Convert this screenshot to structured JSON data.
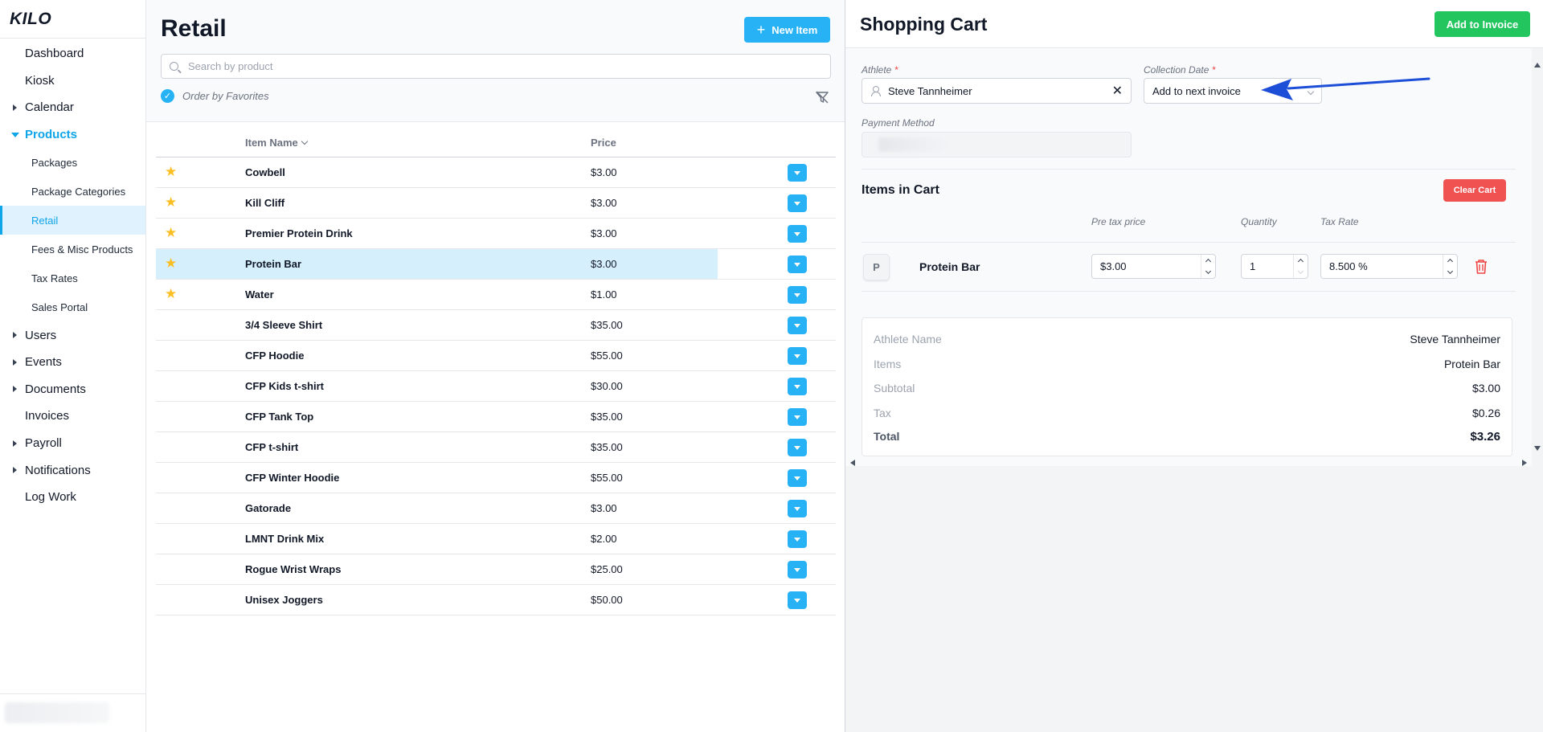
{
  "sidebar": {
    "logo": "KILO",
    "items": [
      {
        "label": "Dashboard",
        "expandable": false
      },
      {
        "label": "Kiosk",
        "expandable": false
      },
      {
        "label": "Calendar",
        "expandable": true
      },
      {
        "label": "Products",
        "expandable": true,
        "open": true
      },
      {
        "label": "Users",
        "expandable": true
      },
      {
        "label": "Events",
        "expandable": true
      },
      {
        "label": "Documents",
        "expandable": true
      },
      {
        "label": "Invoices",
        "expandable": false
      },
      {
        "label": "Payroll",
        "expandable": true
      },
      {
        "label": "Notifications",
        "expandable": true
      },
      {
        "label": "Log Work",
        "expandable": false
      }
    ],
    "products_sub": [
      "Packages",
      "Package Categories",
      "Retail",
      "Fees & Misc Products",
      "Tax Rates",
      "Sales Portal"
    ],
    "active_sub": "Retail"
  },
  "retail": {
    "title": "Retail",
    "new_item_label": "New Item",
    "search_placeholder": "Search by product",
    "order_by_favorites_label": "Order by Favorites",
    "columns": {
      "name": "Item Name",
      "price": "Price"
    },
    "rows": [
      {
        "name": "Cowbell",
        "price": "$3.00",
        "favorite": true
      },
      {
        "name": "Kill Cliff",
        "price": "$3.00",
        "favorite": true
      },
      {
        "name": "Premier Protein Drink",
        "price": "$3.00",
        "favorite": true
      },
      {
        "name": "Protein Bar",
        "price": "$3.00",
        "favorite": true,
        "selected": true
      },
      {
        "name": "Water",
        "price": "$1.00",
        "favorite": true
      },
      {
        "name": "3/4 Sleeve Shirt",
        "price": "$35.00",
        "favorite": false
      },
      {
        "name": "CFP Hoodie",
        "price": "$55.00",
        "favorite": false
      },
      {
        "name": "CFP Kids t-shirt",
        "price": "$30.00",
        "favorite": false
      },
      {
        "name": "CFP Tank Top",
        "price": "$35.00",
        "favorite": false
      },
      {
        "name": "CFP t-shirt",
        "price": "$35.00",
        "favorite": false
      },
      {
        "name": "CFP Winter Hoodie",
        "price": "$55.00",
        "favorite": false
      },
      {
        "name": "Gatorade",
        "price": "$3.00",
        "favorite": false
      },
      {
        "name": "LMNT Drink Mix",
        "price": "$2.00",
        "favorite": false
      },
      {
        "name": "Rogue Wrist Wraps",
        "price": "$25.00",
        "favorite": false
      },
      {
        "name": "Unisex Joggers",
        "price": "$50.00",
        "favorite": false
      }
    ]
  },
  "cart": {
    "title": "Shopping Cart",
    "add_to_invoice_label": "Add to Invoice",
    "athlete_label": "Athlete",
    "athlete_value": "Steve Tannheimer",
    "collection_date_label": "Collection Date",
    "collection_date_value": "Add to next invoice",
    "payment_method_label": "Payment Method",
    "items_title": "Items in Cart",
    "clear_cart_label": "Clear Cart",
    "col_pretax": "Pre tax price",
    "col_quantity": "Quantity",
    "col_tax": "Tax Rate",
    "item": {
      "initial": "P",
      "name": "Protein Bar",
      "pretax": "$3.00",
      "quantity": "1",
      "tax_rate": "8.500 %"
    },
    "summary": [
      {
        "label": "Athlete Name",
        "value": "Steve Tannheimer"
      },
      {
        "label": "Items",
        "value": "Protein Bar"
      },
      {
        "label": "Subtotal",
        "value": "$3.00"
      },
      {
        "label": "Tax",
        "value": "$0.26"
      },
      {
        "label": "Total",
        "value": "$3.26"
      }
    ]
  },
  "colors": {
    "accent": "#27b2f5",
    "success": "#22c55e",
    "danger": "#f05252",
    "annotation": "#1d4ed8"
  }
}
